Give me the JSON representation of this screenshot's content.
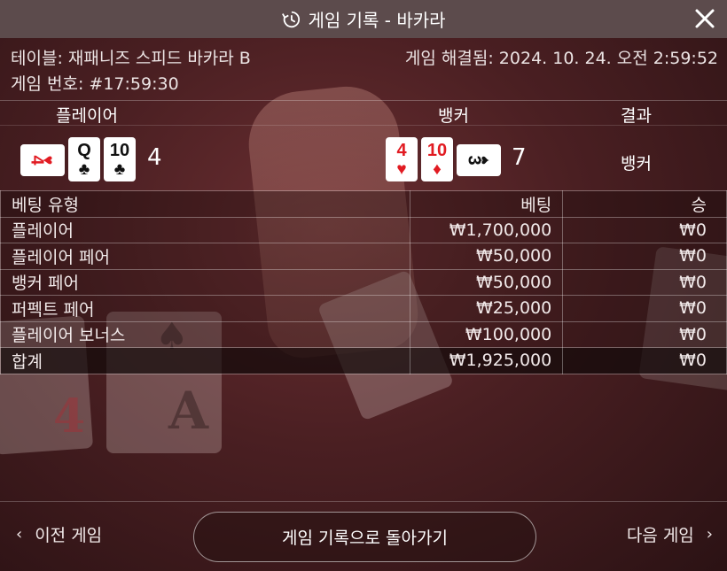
{
  "header": {
    "title": "게임 기록 - 바카라",
    "icon": "history-icon",
    "close_icon": "close-icon"
  },
  "info": {
    "table": "테이블: 재패니즈 스피드 바카라 B",
    "resolved": "게임 해결됨: 2024. 10. 24. 오전 2:59:52",
    "game_number": "게임 번호: #17:59:30"
  },
  "round": {
    "player_label": "플레이어",
    "banker_label": "뱅커",
    "result_label": "결과",
    "player_score": "4",
    "banker_score": "7",
    "result": "뱅커",
    "player_cards": [
      {
        "rank": "4",
        "suit": "♥",
        "color": "red",
        "sideways": true
      },
      {
        "rank": "Q",
        "suit": "♣",
        "color": "black",
        "sideways": false
      },
      {
        "rank": "10",
        "suit": "♣",
        "color": "black",
        "sideways": false
      }
    ],
    "banker_cards": [
      {
        "rank": "4",
        "suit": "♥",
        "color": "red",
        "sideways": false
      },
      {
        "rank": "10",
        "suit": "♦",
        "color": "red",
        "sideways": false
      },
      {
        "rank": "3",
        "suit": "♠",
        "color": "black",
        "sideways": true
      }
    ]
  },
  "bets_table": {
    "headers": [
      "베팅 유형",
      "베팅",
      "승"
    ],
    "rows": [
      {
        "type": "플레이어",
        "bet": "₩1,700,000",
        "win": "₩0"
      },
      {
        "type": "플레이어 페어",
        "bet": "₩50,000",
        "win": "₩0"
      },
      {
        "type": "뱅커 페어",
        "bet": "₩50,000",
        "win": "₩0"
      },
      {
        "type": "퍼펙트 페어",
        "bet": "₩25,000",
        "win": "₩0"
      },
      {
        "type": "플레이어 보너스",
        "bet": "₩100,000",
        "win": "₩0"
      }
    ],
    "total": {
      "type": "합계",
      "bet": "₩1,925,000",
      "win": "₩0"
    }
  },
  "footer": {
    "prev_label": "이전 게임",
    "back_label": "게임 기록으로 돌아가기",
    "next_label": "다음 게임"
  },
  "colors": {
    "header_bg": "#5c4b4c",
    "card_red": "#e11b22",
    "background": "#4a1f22"
  }
}
